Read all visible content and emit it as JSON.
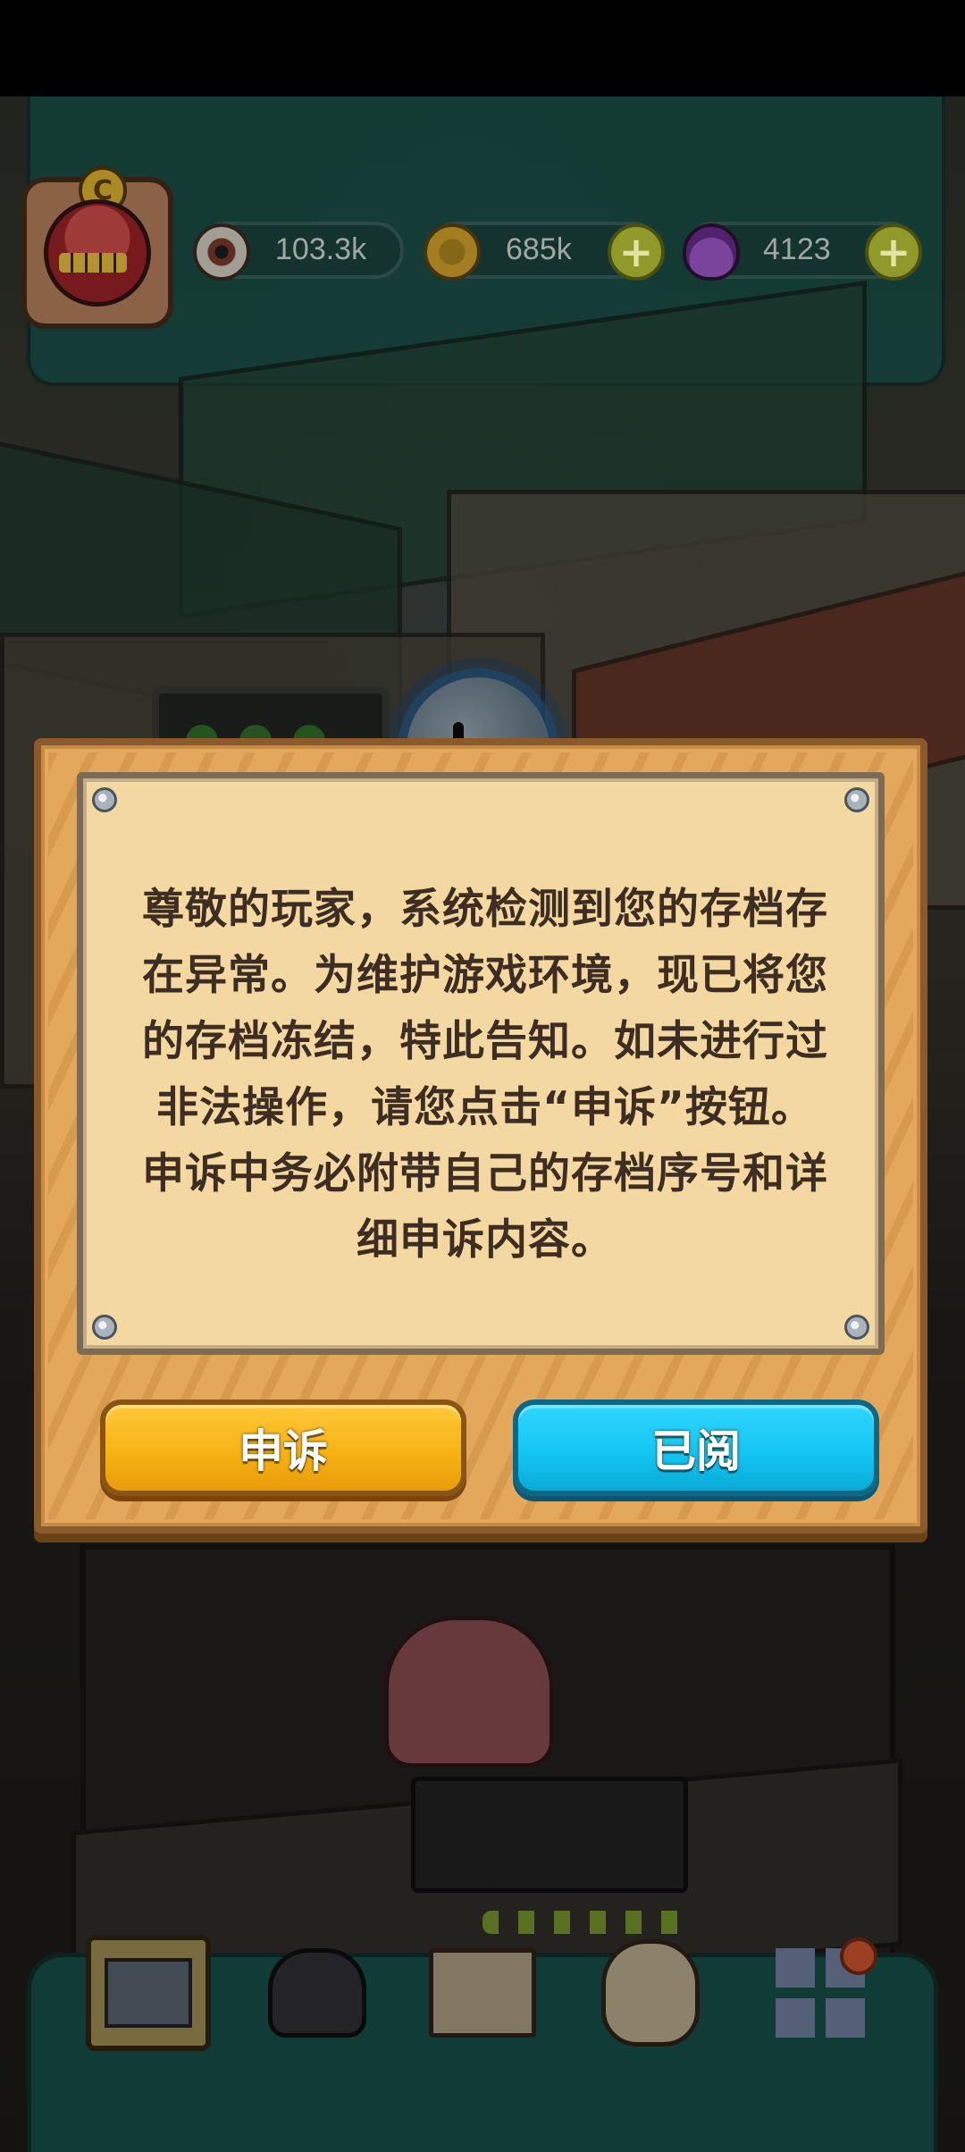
{
  "hud": {
    "avatar_badge": "C",
    "currencies": [
      {
        "icon": "eyeball-icon",
        "value": "103.3k"
      },
      {
        "icon": "coin-icon",
        "value": "685k"
      },
      {
        "icon": "potion-icon",
        "value": "4123"
      }
    ],
    "plus_label": "+"
  },
  "dialog": {
    "message": "尊敬的玩家，系统检测到您的存档存在异常。为维护游戏环境，现已将您的存档冻结，特此告知。如未进行过非法操作，请您点击“申诉”按钮。申诉中务必附带自己的存档序号和详细申诉内容。",
    "appeal_button": "申诉",
    "read_button": "已阅"
  },
  "bottom_nav": {
    "items": [
      "shop-icon",
      "monster-icon",
      "book-icon",
      "bag-icon",
      "grid-menu-icon"
    ]
  },
  "colors": {
    "appeal": "#f6b112",
    "read": "#12c4f0",
    "frame": "#e3a85b",
    "parchment": "#f3d8a1"
  }
}
